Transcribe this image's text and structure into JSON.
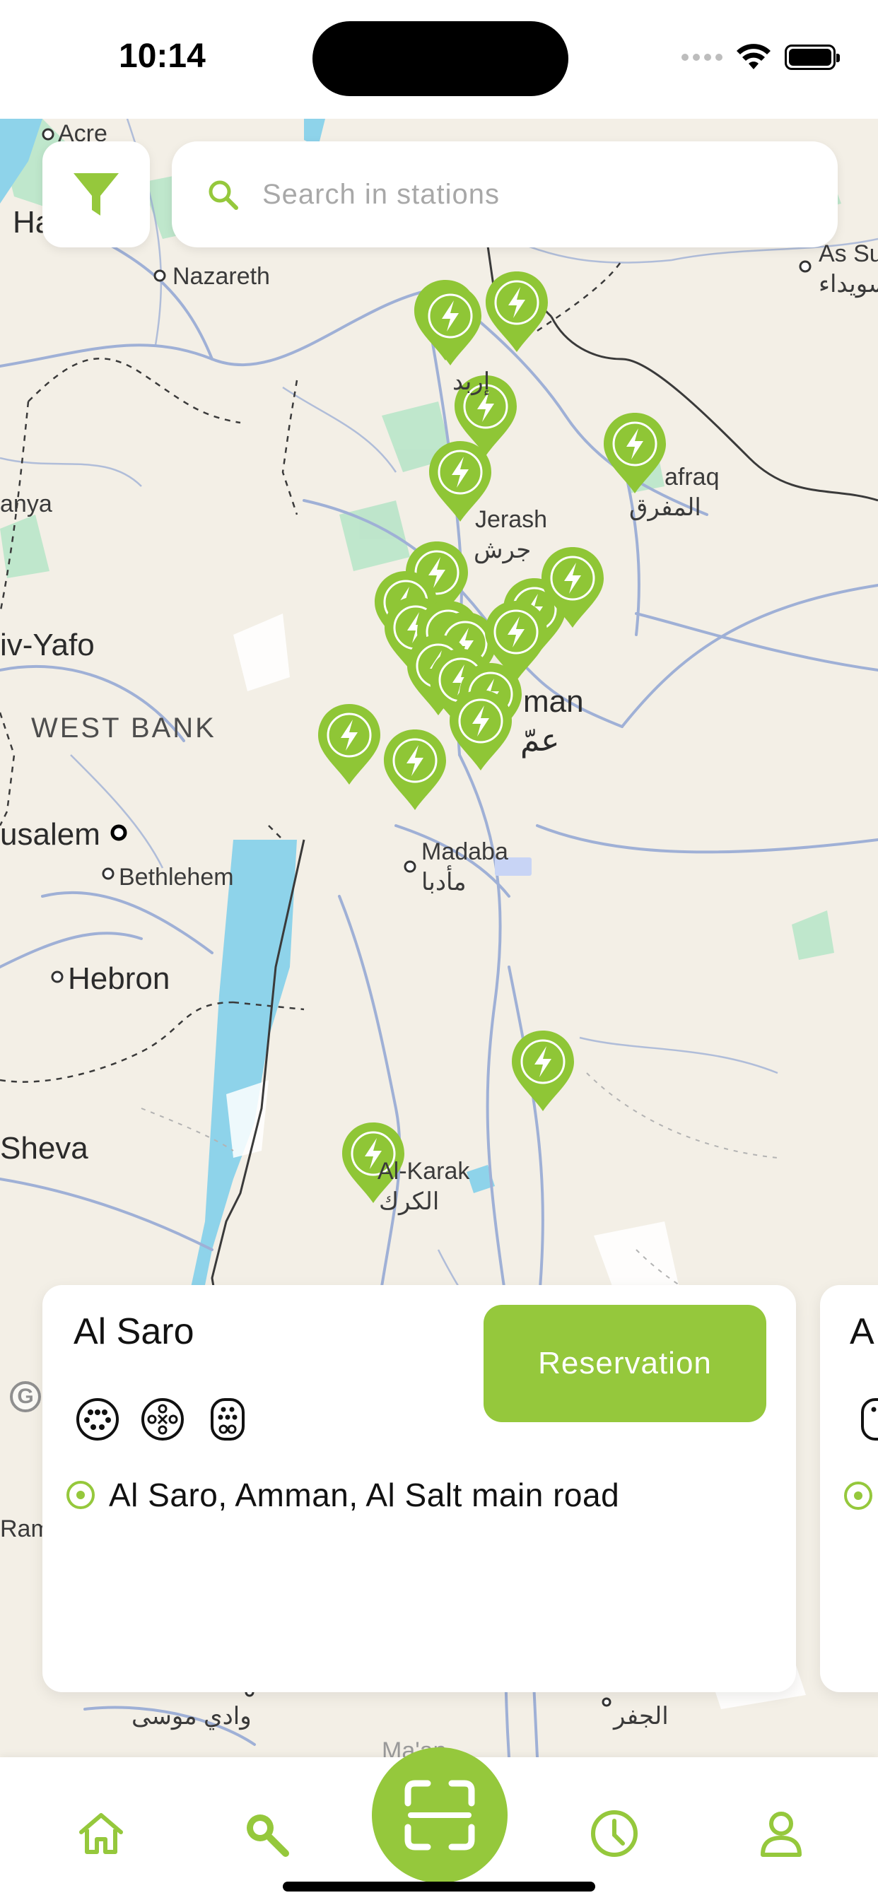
{
  "status_bar": {
    "time": "10:14"
  },
  "search": {
    "placeholder": "Search in stations"
  },
  "map": {
    "labels": {
      "acre": "Acre",
      "haifa": "Ha",
      "nazareth": "Nazareth",
      "as_su_en": "As Su",
      "as_su_ar": "سويداء",
      "netanya": "anya",
      "tel_aviv": "iv-Yafo",
      "west_bank": "WEST BANK",
      "jerusalem": "usalem",
      "bethlehem": "Bethlehem",
      "hebron": "Hebron",
      "beersheva": "Sheva",
      "jerash_en": "Jerash",
      "jerash_ar": "جرش",
      "mafraq_en": "afraq",
      "mafraq_ar": "المفرق",
      "amman_en": "man",
      "amman_ar": "عمّ",
      "madaba_en": "Madaba",
      "madaba_ar": "مأدبا",
      "karak_en": "Al-Karak",
      "karak_ar": "الكرك",
      "irbid_ar": "إربد",
      "wadi_musa_ar": "وادي موسى",
      "jafr_ar": "الجفر",
      "ramon": "Ramo",
      "maan": "Ma'an"
    }
  },
  "station_card": {
    "name": "Al Saro",
    "reserve_label": "Reservation",
    "address": "Al Saro, Amman, Al Salt main road",
    "connectors": [
      "type2-connector-icon",
      "chademo-connector-icon",
      "ccs-connector-icon"
    ]
  },
  "next_card": {
    "peek": "A"
  },
  "google_mark": "G",
  "colors": {
    "accent": "#95c83c",
    "pin": "#8fc636",
    "water": "#8ed3ea",
    "road": "#9fb0d6",
    "green_area": "#b9e5c9"
  },
  "bottom_nav": [
    "home-icon",
    "search-icon",
    "scan-icon",
    "history-icon",
    "profile-icon"
  ]
}
